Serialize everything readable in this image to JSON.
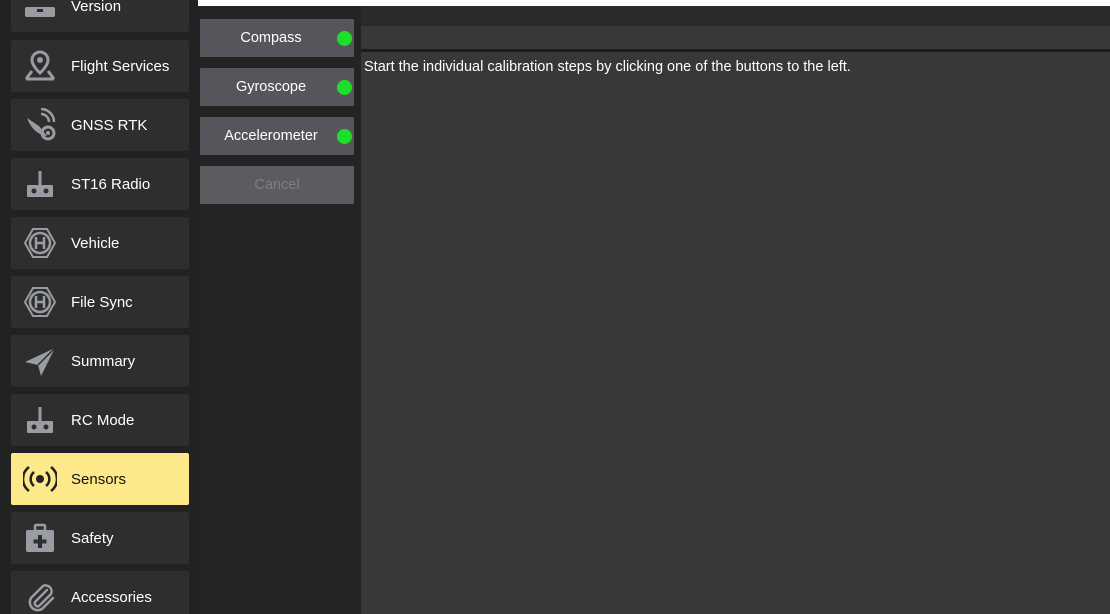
{
  "sidebar": {
    "items": [
      {
        "label": "Version",
        "icon": "version-icon"
      },
      {
        "label": "Flight Services",
        "icon": "map-pin-icon"
      },
      {
        "label": "GNSS RTK",
        "icon": "satellite-gear-icon"
      },
      {
        "label": "ST16 Radio",
        "icon": "radio-controller-icon"
      },
      {
        "label": "Vehicle",
        "icon": "hexacopter-icon"
      },
      {
        "label": "File Sync",
        "icon": "hexacopter-icon"
      },
      {
        "label": "Summary",
        "icon": "paper-plane-icon"
      },
      {
        "label": "RC Mode",
        "icon": "radio-controller-icon"
      },
      {
        "label": "Sensors",
        "icon": "sensor-signal-icon",
        "active": true
      },
      {
        "label": "Safety",
        "icon": "first-aid-icon"
      },
      {
        "label": "Accessories",
        "icon": "paperclip-icon"
      }
    ]
  },
  "calibration": {
    "buttons": [
      {
        "label": "Compass",
        "status": "complete"
      },
      {
        "label": "Gyroscope",
        "status": "complete"
      },
      {
        "label": "Accelerometer",
        "status": "complete"
      }
    ],
    "cancel_label": "Cancel"
  },
  "content": {
    "instruction": "Start the individual calibration steps by clicking one of the buttons to the left."
  },
  "colors": {
    "active_item": "#fde88a",
    "status_ok": "#1fdd2a",
    "panel_bg": "#383838",
    "sidebar_bg": "#222222"
  }
}
